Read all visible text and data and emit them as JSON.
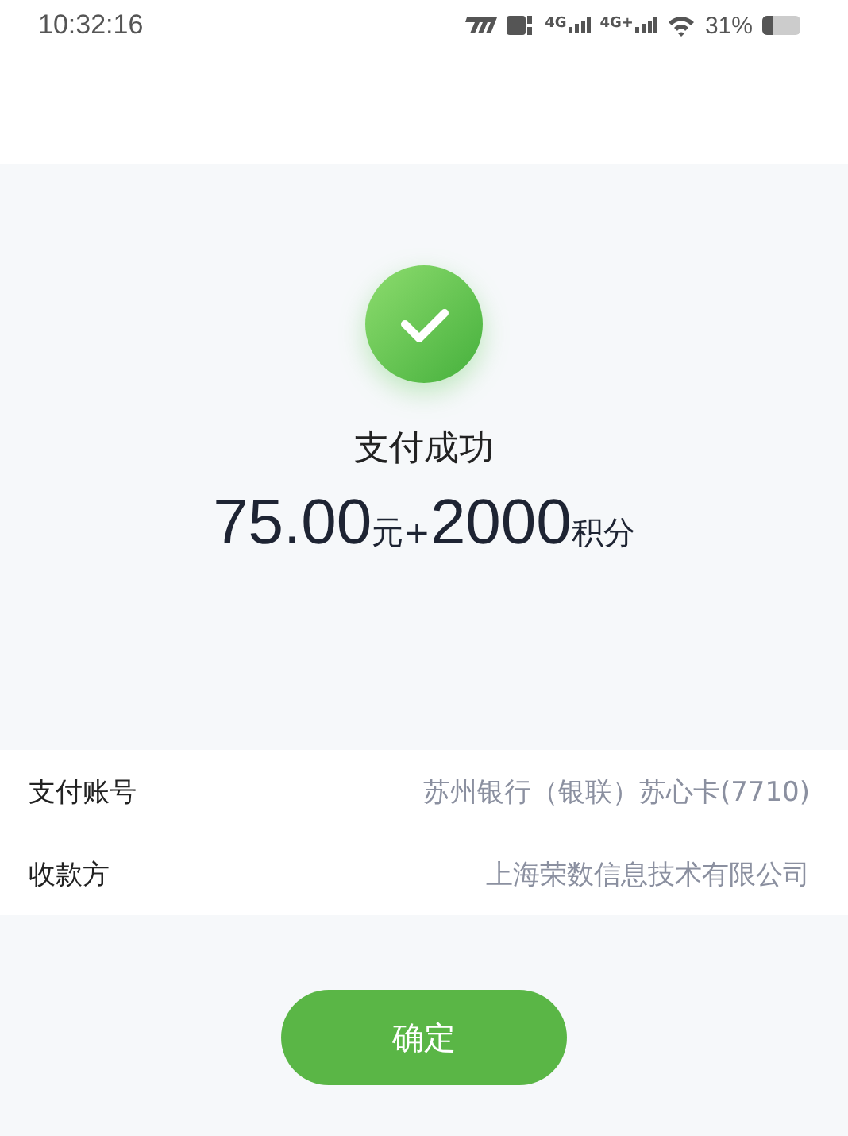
{
  "status_bar": {
    "time": "10:32:16",
    "network_1": "4G",
    "network_2": "4G+",
    "battery_text": "31%"
  },
  "result": {
    "title": "支付成功",
    "amount": [
      {
        "text": "75.00",
        "kind": "number"
      },
      {
        "text": "元+",
        "kind": "unit"
      },
      {
        "text": "2000",
        "kind": "number"
      },
      {
        "text": "积分",
        "kind": "unit"
      }
    ]
  },
  "details": [
    {
      "label": "支付账号",
      "value": "苏州银行（银联）苏心卡(7710)"
    },
    {
      "label": "收款方",
      "value": "上海荣数信息技术有限公司"
    }
  ],
  "confirm_button": "确定"
}
